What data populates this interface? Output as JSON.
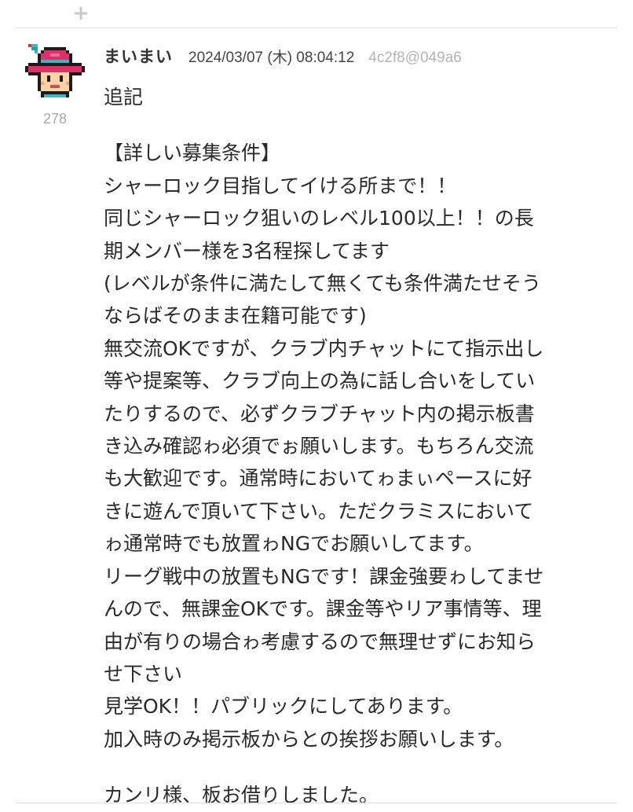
{
  "toolbar": {
    "add_icon": "plus-icon",
    "add_symbol": "+"
  },
  "post": {
    "avatar_icon": "pixel-character-avatar",
    "avatar_count": "278",
    "username": "まいまい",
    "timestamp": "2024/03/07 (木) 08:04:12",
    "post_id": "4c2f8@049a6",
    "heading": "追記",
    "lines": [
      "【詳しい募集条件】",
      "シャーロック目指してイける所まで！！",
      "同じシャーロック狙いのレベル100以上！！の長",
      "期メンバー様を3名程探してます",
      "(レベルが条件に満たして無くても条件満たせそう",
      "ならばそのまま在籍可能です)",
      "無交流OKですが、クラブ内チャットにて指示出し",
      "等や提案等、クラブ向上の為に話し合いをしてい",
      "たりするので、必ずクラブチャット内の掲示板書",
      "き込み確認ゎ必須でぉ願いします。もちろん交流",
      "も大歓迎です。通常時においてゎまぃペースに好",
      "きに遊んで頂いて下さい。ただクラミスにおいて",
      "ゎ通常時でも放置ゎNGでお願いしてます。",
      "リーグ戦中の放置もNGです！課金強要ゎしてませ",
      "んので、無課金OKです。課金等やリア事情等、理",
      "由が有りの場合ゎ考慮するので無理せずにお知ら",
      "せ下さい",
      "見学OK！！パブリックにしてあります。",
      "加入時のみ掲示板からとの挨拶お願いします。"
    ],
    "closing": "カンリ様、板お借りしました。"
  },
  "colors": {
    "background": "#ffffff",
    "text": "#2a2a2a",
    "muted": "#b4b4b4",
    "divider": "#e2e2e2",
    "hat": "#e0306a",
    "hat_band": "#3bb8c4"
  }
}
